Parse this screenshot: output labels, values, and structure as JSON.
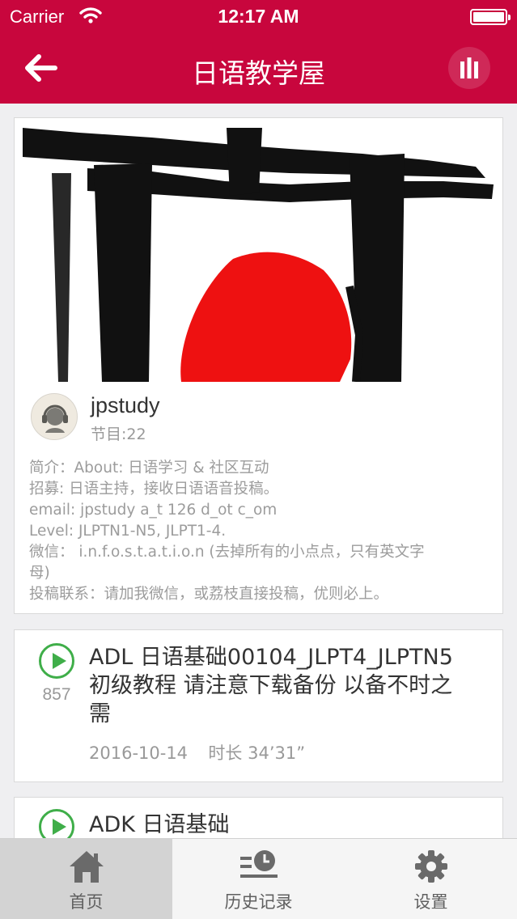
{
  "status_bar": {
    "carrier": "Carrier",
    "time": "12:17 AM"
  },
  "nav": {
    "title": "日语教学屋"
  },
  "podcast": {
    "name": "jpstudy",
    "episode_count": "节目:22",
    "description_lines": [
      "简介：About: 日语学习 & 社区互动",
      "招募: 日语主持，接收日语语音投稿。",
      "email: jpstudy a_t 126 d_ot c_om",
      "Level: JLPTN1-N5, JLPT1-4.",
      "微信：  i.n.f.o.s.t.a.t.i.o.n (去掉所有的小点点，只有英文字",
      "母)",
      "投稿联系：请加我微信，或荔枝直接投稿，优则必上。"
    ]
  },
  "episodes": [
    {
      "title_lines": [
        "ADL 日语基础00104_JLPT4_JLPTN5",
        "初级教程 请注意下载备份 以备不时之",
        "需"
      ],
      "play_count": "857",
      "date": "2016-10-14",
      "duration": "时长 34’31”"
    },
    {
      "title_lines": [
        "ADK 日语基础"
      ],
      "play_count": "",
      "date": "",
      "duration": ""
    }
  ],
  "tabs": [
    {
      "label": "首页",
      "icon": "home-icon",
      "active": true
    },
    {
      "label": "历史记录",
      "icon": "history-icon",
      "active": false
    },
    {
      "label": "设置",
      "icon": "gear-icon",
      "active": false
    }
  ],
  "colors": {
    "brand": "#c8063d",
    "play": "#3fae49",
    "sun": "#ee1111"
  }
}
